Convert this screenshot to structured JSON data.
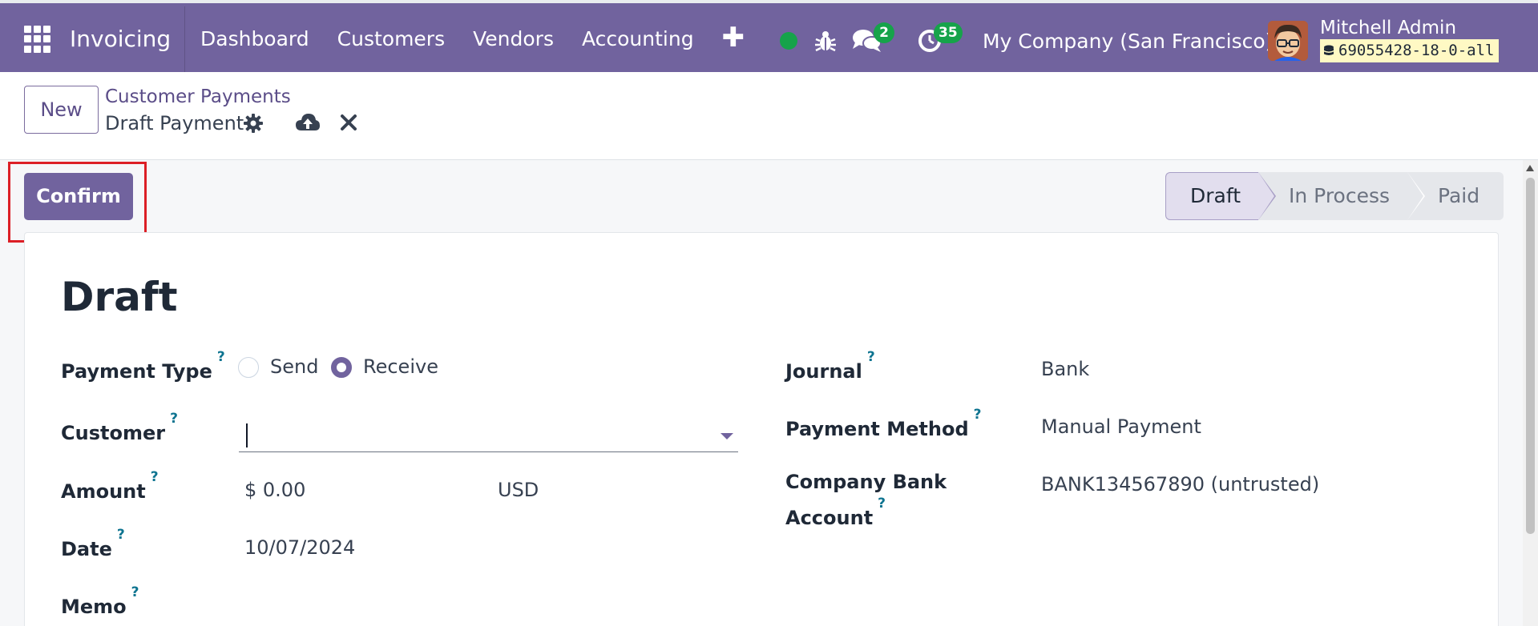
{
  "navbar": {
    "app_name": "Invoicing",
    "menu": [
      "Dashboard",
      "Customers",
      "Vendors",
      "Accounting"
    ],
    "plus_glyph": "✚",
    "chat_count": "2",
    "activity_count": "35",
    "company": "My Company (San Francisco)",
    "user_name": "Mitchell Admin",
    "database": "69055428-18-0-all",
    "colors": {
      "bar": "#71639e",
      "online": "#16a34a",
      "db_chip": "#fff9c4"
    }
  },
  "control_panel": {
    "new_label": "New",
    "breadcrumb_parent": "Customer Payments",
    "breadcrumb_current": "Draft Payment"
  },
  "actions": {
    "confirm_label": "Confirm"
  },
  "statusbar": {
    "steps": [
      "Draft",
      "In Process",
      "Paid"
    ],
    "active": "Draft"
  },
  "form": {
    "title": "Draft",
    "help_glyph": "?",
    "payment_type": {
      "label": "Payment Type",
      "options": [
        "Send",
        "Receive"
      ],
      "selected": "Receive"
    },
    "customer": {
      "label": "Customer",
      "value": ""
    },
    "amount": {
      "label": "Amount",
      "value": "$ 0.00",
      "currency": "USD"
    },
    "date": {
      "label": "Date",
      "value": "10/07/2024"
    },
    "memo": {
      "label": "Memo",
      "value": ""
    },
    "journal": {
      "label": "Journal",
      "value": "Bank"
    },
    "payment_method": {
      "label": "Payment Method",
      "value": "Manual Payment"
    },
    "company_bank_account": {
      "label_line1": "Company Bank",
      "label_line2": "Account",
      "value": "BANK134567890 (untrusted)"
    }
  }
}
